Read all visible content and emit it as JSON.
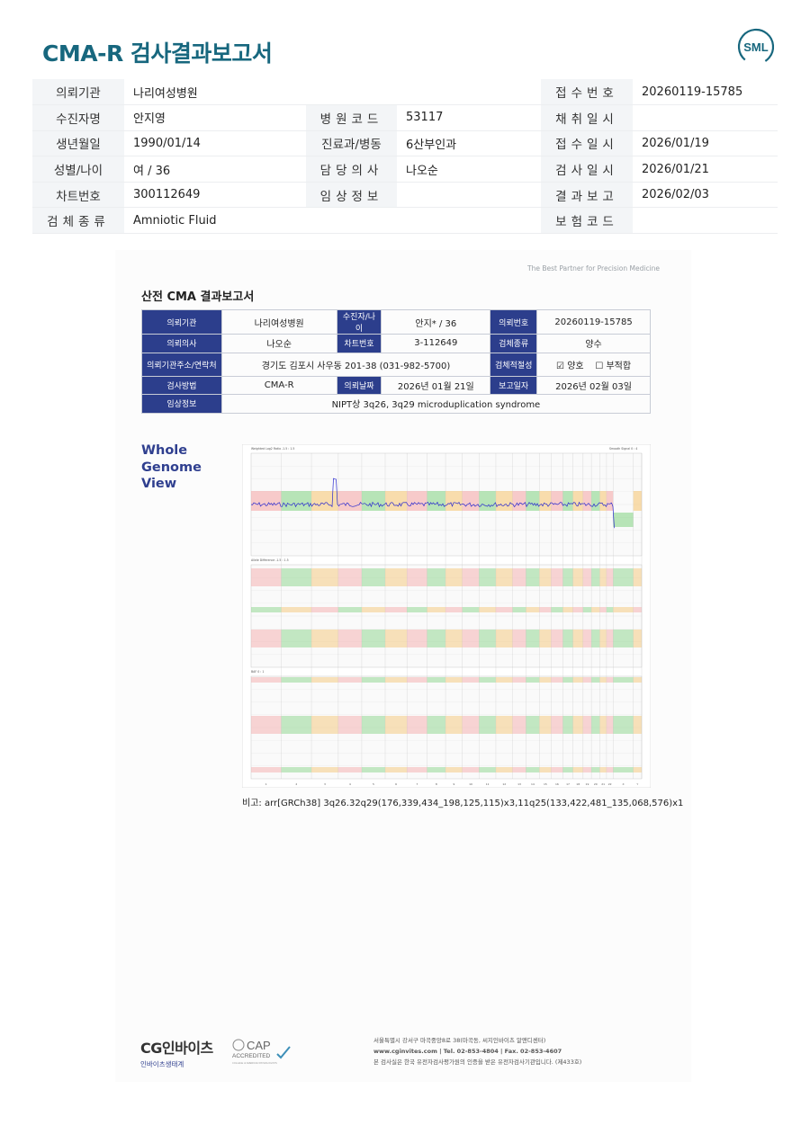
{
  "header": {
    "title": "CMA-R 검사결과보고서",
    "logo_text": "SML"
  },
  "info": {
    "rows": [
      [
        {
          "label": "의뢰기관",
          "value": "나리여성병원"
        },
        {
          "label": "",
          "value": ""
        },
        {
          "label": "접수번호",
          "value": "20260119-15785"
        }
      ],
      [
        {
          "label": "수진자명",
          "value": "안지영"
        },
        {
          "label": "병원코드",
          "value": "53117"
        },
        {
          "label": "채취일시",
          "value": ""
        }
      ],
      [
        {
          "label": "생년월일",
          "value": "1990/01/14"
        },
        {
          "label": "진료과/병동",
          "value": "6산부인과"
        },
        {
          "label": "접수일시",
          "value": "2026/01/19"
        }
      ],
      [
        {
          "label": "성별/나이",
          "value": "여 / 36"
        },
        {
          "label": "담당의사",
          "value": "나오순"
        },
        {
          "label": "검사일시",
          "value": "2026/01/21"
        }
      ],
      [
        {
          "label": "차트번호",
          "value": "300112649"
        },
        {
          "label": "임상정보",
          "value": ""
        },
        {
          "label": "결과보고",
          "value": "2026/02/03"
        }
      ],
      [
        {
          "label": "검체종류",
          "value": "Amniotic Fluid"
        },
        {
          "label": "",
          "value": ""
        },
        {
          "label": "보험코드",
          "value": ""
        }
      ]
    ]
  },
  "report": {
    "tagline": "The Best Partner for Precision Medicine",
    "title": "산전 CMA 결과보고서",
    "r1": {
      "l1": "의뢰기관",
      "v1": "나리여성병원",
      "l2": "수진자/나이",
      "v2": "안지* / 36",
      "l3": "의뢰번호",
      "v3": "20260119-15785"
    },
    "r2": {
      "l1": "의뢰의사",
      "v1": "나오순",
      "l2": "차트번호",
      "v2": "3-112649",
      "l3": "검체종류",
      "v3": "양수"
    },
    "r3": {
      "l1": "의뢰기관주소/연락처",
      "v1": "경기도 김포시 사우동 201-38 (031-982-5700)",
      "l3": "검체적절성",
      "opt1": "☑ 양호",
      "opt2": "☐ 부적합"
    },
    "r4": {
      "l1": "검사방법",
      "v1": "CMA-R",
      "l2": "의뢰날짜",
      "v2": "2026년 01월 21일",
      "l3": "보고일자",
      "v3": "2026년 02월 03일"
    },
    "r5": {
      "l1": "임상정보",
      "v1": "NIPT상 3q26, 3q29 microduplication syndrome"
    },
    "wgv": {
      "line1": "Whole",
      "line2": "Genome",
      "line3": "View"
    },
    "plot_labels": {
      "panel1": "Weighted Log2 Ratio -1.5 : 1.5",
      "panel1_right": "Smooth Signal 0 : 4",
      "panel2": "Allele Difference -1.5 : 1.5",
      "panel3": "BAF 0 : 1",
      "chromosomes": [
        "1",
        "2",
        "3",
        "4",
        "5",
        "6",
        "7",
        "8",
        "9",
        "10",
        "11",
        "12",
        "13",
        "14",
        "15",
        "16",
        "17",
        "18",
        "19",
        "20",
        "21",
        "22",
        "X",
        "Y"
      ]
    },
    "remark": "비고: arr[GRCh38] 3q26.32q29(176,339,434_198,125,115)x3,11q25(133,422,481_135,068,576)x1"
  },
  "footer": {
    "cg_main": "CG인바이츠",
    "cg_sub": "인바이츠생태계",
    "cap_main": "CAP",
    "cap_sub": "ACCREDITED",
    "cap_small": "COLLEGE of AMERICAN PATHOLOGISTS",
    "line1": "서울특별시 강서구 마곡중앙8로 38(마곡동, 씨지인바이츠 알앤디센터)",
    "line2": "www.cginvites.com  |  Tel. 02-853-4804  |  Fax. 02-853-4607",
    "line3": "본 검사실은 한국 유전자검사평가원의 인증을 받은 유전자검사기관입니다. (제433호)"
  },
  "colors": {
    "title": "#17677e",
    "header_cell": "#2c3e8c",
    "chrom_colors": [
      "#f4a3a3",
      "#7fd17f",
      "#f5c26b"
    ]
  }
}
